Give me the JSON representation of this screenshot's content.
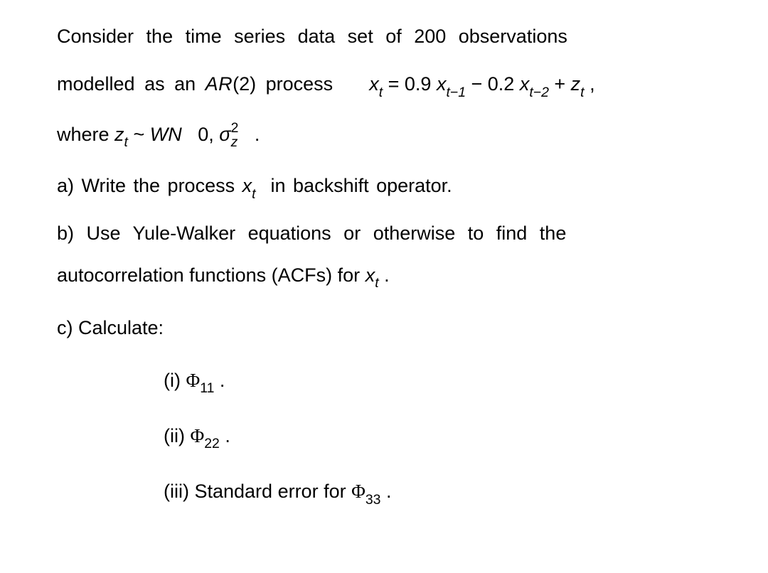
{
  "intro": {
    "line1": "Consider the time series data set of 200 observations",
    "line2_pre": "modelled as an ",
    "ar_label": "AR",
    "ar_order": "(2)",
    "line2_post": " process",
    "eq_x": "x",
    "eq_t": "t",
    "eq_eq": " = 0.9 ",
    "eq_tm1": "t−1",
    "eq_minus": " − 0.2 ",
    "eq_tm2": "t−2",
    "eq_plus": " + ",
    "eq_z": "z",
    "eq_comma": " ,",
    "line3_where": "where ",
    "line3_tilde": " ~ ",
    "wn": "WN",
    "zero": " 0, ",
    "sigma": "σ",
    "z_sub": "z",
    "two": "2",
    "period": " ."
  },
  "parts": {
    "a_pre": "a)  Write  the process ",
    "a_post": " in backshift operator.",
    "b_line1": "b)  Use  Yule-Walker  equations  or  otherwise  to  find  the",
    "b_line2_pre": "autocorrelation functions (ACFs) for ",
    "b_line2_post": " .",
    "c": "c) Calculate:",
    "items": [
      {
        "label": "(i) ",
        "phi": "Φ",
        "sub": "11",
        "post": " ."
      },
      {
        "label": "(ii) ",
        "phi": "Φ",
        "sub": "22",
        "post": " ."
      },
      {
        "label": "(iii) Standard error for ",
        "phi": "Φ",
        "sub": "33",
        "post": " ."
      }
    ]
  }
}
